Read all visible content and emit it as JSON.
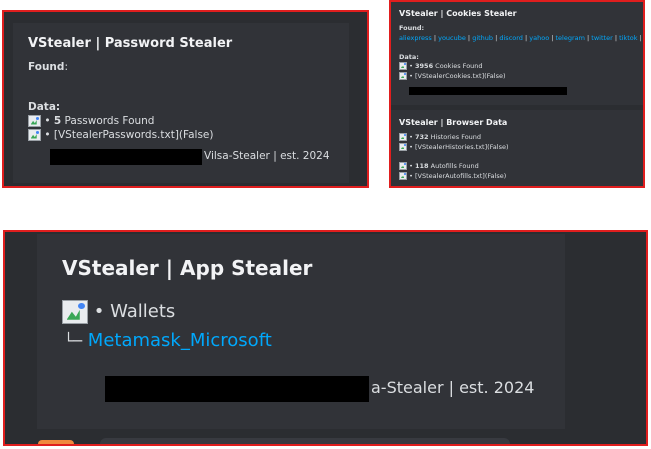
{
  "colors": {
    "frame_border": "#e01e1e",
    "embed_bg": "#313338",
    "link": "#00a8fc",
    "text": "#dbdee1"
  },
  "password_card": {
    "title": "VStealer | Password Stealer",
    "found_label": "Found",
    "found_colon": ":",
    "data_label": "Data:",
    "line1_count": "5",
    "line1_text": "Passwords Found",
    "line2_text": "[VStealerPasswords.txt](False)",
    "footer": "Vilsa-Stealer | est. 2024"
  },
  "cookies_card": {
    "title": "VStealer | Cookies Stealer",
    "found_label": "Found:",
    "sites": [
      "aliexpress",
      "youcube",
      "github",
      "discord",
      "yahoo",
      "telegram",
      "twitter",
      "tiktok",
      "am"
    ],
    "data_label": "Data:",
    "line1_count": "3956",
    "line1_text": "Cookies Found",
    "line2_text": "[VStealerCookies.txt](False)"
  },
  "browser_card": {
    "title": "VStealer | Browser Data",
    "line1_count": "732",
    "line1_text": "Histories Found",
    "line2_text": "[VStealerHistories.txt](False)",
    "line3_count": "118",
    "line3_text": "Autofills Found",
    "line4_text": "[VStealerAutofills.txt](False)"
  },
  "app_card": {
    "title": "VStealer | App Stealer",
    "wallets_label": "• Wallets",
    "tree_glyph": "└─",
    "wallet_link": "Metamask_Microsoft",
    "footer": "a-Stealer | est. 2024"
  },
  "bullet": "•"
}
